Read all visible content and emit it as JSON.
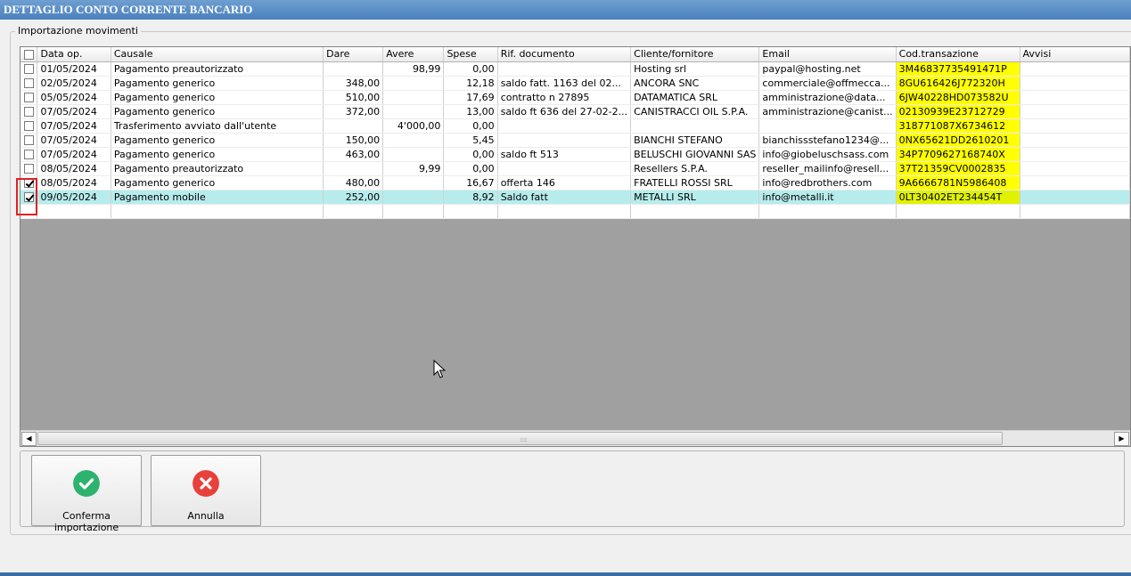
{
  "window": {
    "title": "DETTAGLIO CONTO CORRENTE BANCARIO"
  },
  "group": {
    "legend": "Importazione movimenti"
  },
  "grid": {
    "columns": [
      "Data op.",
      "Causale",
      "Dare",
      "Avere",
      "Spese",
      "Rif. documento",
      "Cliente/fornitore",
      "Email",
      "Cod.transazione",
      "Avvisi"
    ],
    "rows": [
      {
        "checked": false,
        "selected": false,
        "data": "01/05/2024",
        "causale": "Pagamento preautorizzato",
        "dare": "",
        "avere": "98,99",
        "spese": "0,00",
        "rif": "",
        "cliente": "Hosting srl",
        "email": "paypal@hosting.net",
        "codice": "3M46837735491471P",
        "avvisi": ""
      },
      {
        "checked": false,
        "selected": false,
        "data": "02/05/2024",
        "causale": "Pagamento generico",
        "dare": "348,00",
        "avere": "",
        "spese": "12,18",
        "rif": "saldo fatt.   1163 del 02...",
        "cliente": "ANCORA SNC",
        "email": "commerciale@offmecca...",
        "codice": "8GU616426J772320H",
        "avvisi": ""
      },
      {
        "checked": false,
        "selected": false,
        "data": "05/05/2024",
        "causale": "Pagamento generico",
        "dare": "510,00",
        "avere": "",
        "spese": "17,69",
        "rif": "contratto n 27895",
        "cliente": "DATAMATICA SRL",
        "email": "amministrazione@data...",
        "codice": "6JW40228HD073582U",
        "avvisi": ""
      },
      {
        "checked": false,
        "selected": false,
        "data": "07/05/2024",
        "causale": "Pagamento generico",
        "dare": "372,00",
        "avere": "",
        "spese": "13,00",
        "rif": "saldo ft 636 del 27-02-2...",
        "cliente": "CANISTRACCI OIL S.P.A.",
        "email": "amministrazione@canist...",
        "codice": "02130939E23712729",
        "avvisi": ""
      },
      {
        "checked": false,
        "selected": false,
        "data": "07/05/2024",
        "causale": "Trasferimento avviato dall'utente",
        "dare": "",
        "avere": "4'000,00",
        "spese": "0,00",
        "rif": "",
        "cliente": "",
        "email": "",
        "codice": "318771087X6734612",
        "avvisi": ""
      },
      {
        "checked": false,
        "selected": false,
        "data": "07/05/2024",
        "causale": "Pagamento generico",
        "dare": "150,00",
        "avere": "",
        "spese": "5,45",
        "rif": "",
        "cliente": "BIANCHI STEFANO",
        "email": "bianchissstefano1234@...",
        "codice": "0NX65621DD2610201",
        "avvisi": ""
      },
      {
        "checked": false,
        "selected": false,
        "data": "07/05/2024",
        "causale": "Pagamento generico",
        "dare": "463,00",
        "avere": "",
        "spese": "0,00",
        "rif": "saldo ft 513",
        "cliente": "BELUSCHI GIOVANNI SAS",
        "email": "info@giobeluschsass.com",
        "codice": "34P7709627168740X",
        "avvisi": ""
      },
      {
        "checked": false,
        "selected": false,
        "data": "08/05/2024",
        "causale": "Pagamento preautorizzato",
        "dare": "",
        "avere": "9,99",
        "spese": "0,00",
        "rif": "",
        "cliente": "Resellers S.P.A.",
        "email": "reseller_mailinfo@resell...",
        "codice": "37T21359CV0002835",
        "avvisi": ""
      },
      {
        "checked": true,
        "selected": false,
        "data": "08/05/2024",
        "causale": "Pagamento generico",
        "dare": "480,00",
        "avere": "",
        "spese": "16,67",
        "rif": "offerta 146",
        "cliente": "FRATELLI ROSSI SRL",
        "email": "info@redbrothers.com",
        "codice": "9A6666781N5986408",
        "avvisi": ""
      },
      {
        "checked": true,
        "selected": true,
        "data": "09/05/2024",
        "causale": "Pagamento mobile",
        "dare": "252,00",
        "avere": "",
        "spese": "8,92",
        "rif": "Saldo fatt",
        "cliente": "METALLI SRL",
        "email": "info@metalli.it",
        "codice": "0LT30402ET234454T",
        "avvisi": ""
      }
    ]
  },
  "buttons": {
    "confirm": {
      "label": "Conferma importazione",
      "icon": "check-icon",
      "color": "#2db36f"
    },
    "cancel": {
      "label": "Annulla",
      "icon": "close-icon",
      "color": "#e8413b"
    }
  },
  "colors": {
    "highlight_code": "#ffff00",
    "selected_row": "#b7ecec",
    "titlebar": "#4a80bd",
    "annotation_box": "#e02020"
  }
}
